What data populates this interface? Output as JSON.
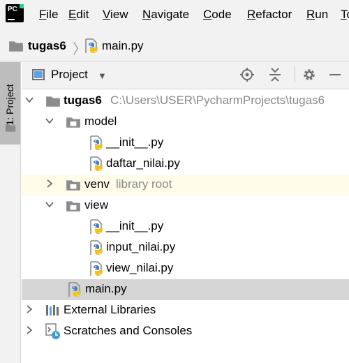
{
  "app": {
    "logo_text": "PC"
  },
  "menu": [
    "File",
    "Edit",
    "View",
    "Navigate",
    "Code",
    "Refactor",
    "Run",
    "To"
  ],
  "breadcrumb": {
    "project": "tugas6",
    "file": "main.py"
  },
  "stripe": {
    "tab_label": "1: Project"
  },
  "toolwindow": {
    "title": "Project"
  },
  "tree": {
    "root": {
      "name": "tugas6",
      "path": "C:\\Users\\USER\\PycharmProjects\\tugas6"
    },
    "model": {
      "name": "model",
      "files": [
        "__init__.py",
        "daftar_nilai.py"
      ]
    },
    "venv": {
      "name": "venv",
      "hint": "library root"
    },
    "view": {
      "name": "view",
      "files": [
        "__init__.py",
        "input_nilai.py",
        "view_nilai.py"
      ]
    },
    "main": "main.py",
    "external": "External Libraries",
    "scratches": "Scratches and Consoles"
  },
  "colors": {
    "selected_row": "#d5d5d5",
    "library_row": "#fffde9",
    "chrome": "#f2f2f2",
    "folder": "#8c8c8c"
  }
}
